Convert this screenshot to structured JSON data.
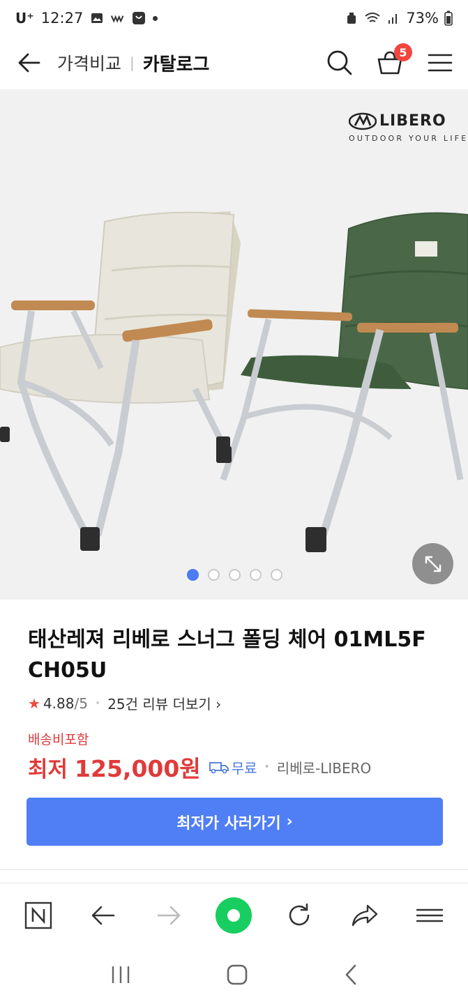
{
  "status_bar": {
    "carrier": "U⁺",
    "time": "12:27",
    "battery": "73%",
    "icons": [
      "image-icon",
      "wavve-icon",
      "shopping-bag-icon",
      "notification-dot-icon",
      "alarm-icon",
      "wifi-icon",
      "signal-icon",
      "battery-icon"
    ]
  },
  "header": {
    "breadcrumb": "가격비교",
    "current": "카탈로그",
    "cart_count": "5"
  },
  "gallery": {
    "brand_name": "LIBERO",
    "brand_tagline": "OUTDOOR YOUR LIFE",
    "slide_count": 5,
    "active_slide": 1,
    "colors": {
      "chair_left": "#e8e6dc",
      "chair_right": "#4a6848",
      "armrest": "#c08a52",
      "frame": "#c9ccd0"
    }
  },
  "product": {
    "title": "태산레져 리베로 스너그 폴딩 체어 01ML5F CH05U",
    "rating": "4.88",
    "rating_max": "/5",
    "review_link": "25건 리뷰 더보기",
    "shipping_note": "배송비포함",
    "price_label": "최저",
    "price": "125,000원",
    "delivery": "무료",
    "seller": "리베로-LIBERO"
  },
  "buy_button": {
    "label": "최저가 사러가기"
  },
  "colors": {
    "accent_blue": "#4f7ef5",
    "price_red": "#e03a3a",
    "badge_red": "#f2453d",
    "naver_green": "#19ce60"
  }
}
